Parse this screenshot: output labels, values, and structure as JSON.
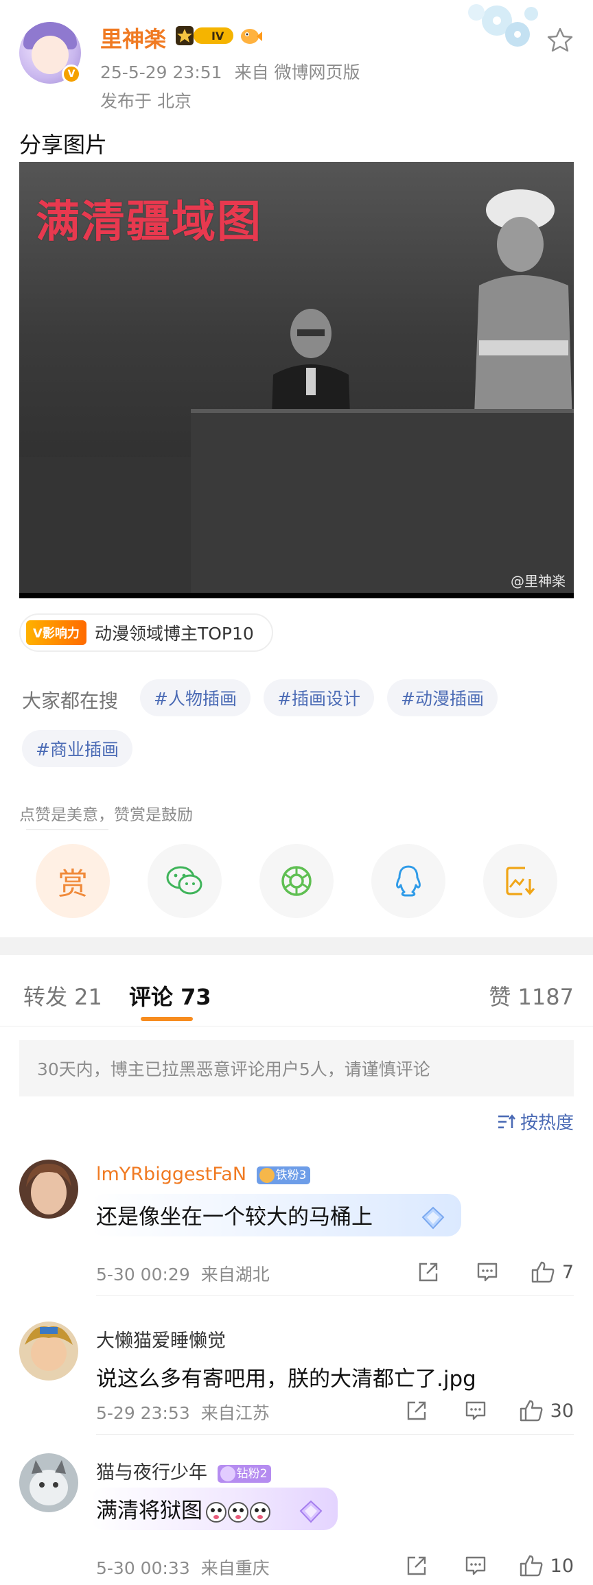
{
  "post": {
    "author": "里神楽",
    "level_badge": "IV",
    "time": "25-5-29 23:51",
    "source": "来自 微博网页版",
    "location": "发布于 北京",
    "text": "分享图片",
    "image_caption": "满清疆域图",
    "image_watermark": "@里神楽"
  },
  "influence": {
    "badge": "V影响力",
    "text": "动漫领域博主TOP10"
  },
  "search": {
    "label": "大家都在搜",
    "tags": [
      "#人物插画",
      "#插画设计",
      "#动漫插画",
      "#商业插画"
    ]
  },
  "praise": {
    "text": "点赞是美意，赞赏是鼓励",
    "reward_label": "赏"
  },
  "share_icons": [
    "reward-icon",
    "wechat-icon",
    "moments-icon",
    "qq-icon",
    "save-image-icon"
  ],
  "tabs": {
    "repost": "转发 21",
    "comments": "评论 73",
    "likes": "赞 1187"
  },
  "notice": "30天内，博主已拉黑恶意评论用户5人，请谨慎评论",
  "sort_label": "按热度",
  "comments": [
    {
      "name": "lmYRbiggestFaN",
      "badge": "铁粉3",
      "text": "还是像坐在一个较大的马桶上",
      "time": "5-30 00:29",
      "from": "来自湖北",
      "likes": "7"
    },
    {
      "name": "大懒猫爱睡懒觉",
      "badge": "",
      "text": "说这么多有寄吧用，朕的大清都亡了.jpg",
      "time": "5-29 23:53",
      "from": "来自江苏",
      "likes": "30"
    },
    {
      "name": "猫与夜行少年",
      "badge": "钻粉2",
      "text": "满清将狱图",
      "time": "5-30 00:33",
      "from": "来自重庆",
      "likes": "10"
    }
  ],
  "colors": {
    "accent": "#f78c1f",
    "username": "#f07a22",
    "link": "#4b6bb5",
    "caption_red": "#e8394f"
  }
}
